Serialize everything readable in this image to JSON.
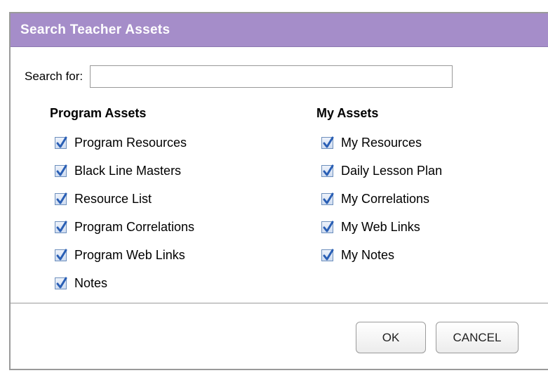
{
  "dialog": {
    "title": "Search Teacher Assets"
  },
  "search": {
    "label": "Search for:",
    "value": ""
  },
  "program_assets": {
    "heading": "Program Assets",
    "items": [
      {
        "label": "Program Resources",
        "checked": true
      },
      {
        "label": "Black Line Masters",
        "checked": true
      },
      {
        "label": "Resource List",
        "checked": true
      },
      {
        "label": "Program Correlations",
        "checked": true
      },
      {
        "label": "Program Web Links",
        "checked": true
      },
      {
        "label": "Notes",
        "checked": true
      }
    ]
  },
  "my_assets": {
    "heading": "My Assets",
    "items": [
      {
        "label": "My Resources",
        "checked": true
      },
      {
        "label": "Daily Lesson Plan",
        "checked": true
      },
      {
        "label": "My Correlations",
        "checked": true
      },
      {
        "label": "My Web Links",
        "checked": true
      },
      {
        "label": "My Notes",
        "checked": true
      }
    ]
  },
  "buttons": {
    "ok": "OK",
    "cancel": "CANCEL"
  },
  "colors": {
    "title_bar": "#a58dc9",
    "checkmark": "#2a5fb5"
  }
}
